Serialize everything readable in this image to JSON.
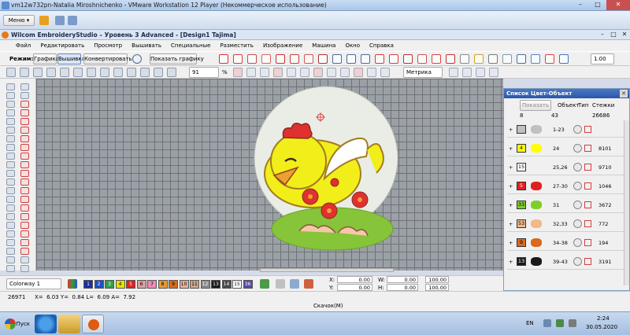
{
  "vm_window": {
    "title": "vm12w732pn-Natalia Miroshnichenko - VMware Workstation 12 Player (Некоммерческое использование)"
  },
  "vm_toolbar": {
    "menu_label": "Меню"
  },
  "app": {
    "title": "Wilcom EmbroideryStudio – Уровень 3 Advanced - [Design1       Tajima]"
  },
  "menu": {
    "items": [
      "Файл",
      "Редактировать",
      "Просмотр",
      "Вышивать",
      "Специальные",
      "Разместить",
      "Изображение",
      "Машина",
      "Окно",
      "Справка"
    ]
  },
  "toolbar1": {
    "mode_label": "Режим:",
    "graphics_label": "Графика",
    "embroidery_label": "Вышивка",
    "convert_label": "Конвертировать",
    "show_graphics_label": "Показать графику",
    "scale_value": "1.00"
  },
  "toolbar2": {
    "zoom_value": "91",
    "zoom_unit": "%",
    "view_mode_value": "Метрика"
  },
  "panel": {
    "title": "Список Цвет-Объект",
    "show_label": "Показать",
    "col_object": "Объект",
    "col_type": "Тип",
    "col_stitches": "Стежки",
    "totals": {
      "colors": "8",
      "objects": "43",
      "stitches": "26686"
    },
    "rows": [
      {
        "num": "",
        "range": "1-23",
        "stitches": "",
        "color": "#c0c0c0"
      },
      {
        "num": "4",
        "range": "24",
        "stitches": "8101",
        "color": "#ffff00"
      },
      {
        "num": "15",
        "range": "25,26",
        "stitches": "9710",
        "color": "#ffffff"
      },
      {
        "num": "5",
        "range": "27-30",
        "stitches": "1046",
        "color": "#e02020"
      },
      {
        "num": "33",
        "range": "31",
        "stitches": "3672",
        "color": "#7fcf2a"
      },
      {
        "num": "53",
        "range": "32,33",
        "stitches": "772",
        "color": "#f3b98a"
      },
      {
        "num": "9",
        "range": "34-38",
        "stitches": "194",
        "color": "#d96a1e"
      },
      {
        "num": "13",
        "range": "39-43",
        "stitches": "3191",
        "color": "#1a1a1a"
      }
    ]
  },
  "statusbar": {
    "colorway_label": "Colorway 1",
    "swatches": [
      {
        "n": "1",
        "color": "#1a2fa0"
      },
      {
        "n": "2",
        "color": "#1d4fc4"
      },
      {
        "n": "3",
        "color": "#2fa14a"
      },
      {
        "n": "4",
        "color": "#e8e000"
      },
      {
        "n": "5",
        "color": "#e02020"
      },
      {
        "n": "6",
        "color": "#d9a0a0"
      },
      {
        "n": "7",
        "color": "#f08ab5"
      },
      {
        "n": "8",
        "color": "#e49a3a"
      },
      {
        "n": "9",
        "color": "#d96a1e"
      },
      {
        "n": "10",
        "color": "#e8b0a0"
      },
      {
        "n": "11",
        "color": "#c8a88a"
      },
      {
        "n": "12",
        "color": "#8a8a8a"
      },
      {
        "n": "13",
        "color": "#1a1a1a"
      },
      {
        "n": "14",
        "color": "#4a4a4a"
      },
      {
        "n": "15",
        "color": "#ffffff"
      },
      {
        "n": "36",
        "color": "#5a4aa0"
      }
    ],
    "x_label": "X:",
    "y_label": "Y:",
    "w_label": "W:",
    "h_label": "H:",
    "x_value": "0.00",
    "y_value": "0.00",
    "w_value": "0.00",
    "h_value": "0.00",
    "pct1": "100.00",
    "pct2": "100.00"
  },
  "coords": {
    "stitch_count": "26971",
    "readout": "X=  6.03 Y=  0.84 L=  6.09 A=  7.92"
  },
  "download": {
    "label": "Скачок(M)"
  },
  "taskbar": {
    "start_label": "Пуск",
    "lang": "EN",
    "time": "2:24",
    "date": "30.05.2020"
  },
  "colors": {
    "canvas_bg": "#9aa0a6",
    "title_blue": "#2a56a8",
    "hoop_fill": "#e9ede6",
    "chicken_yellow": "#f2ee1a",
    "grass_green": "#86c43a"
  }
}
